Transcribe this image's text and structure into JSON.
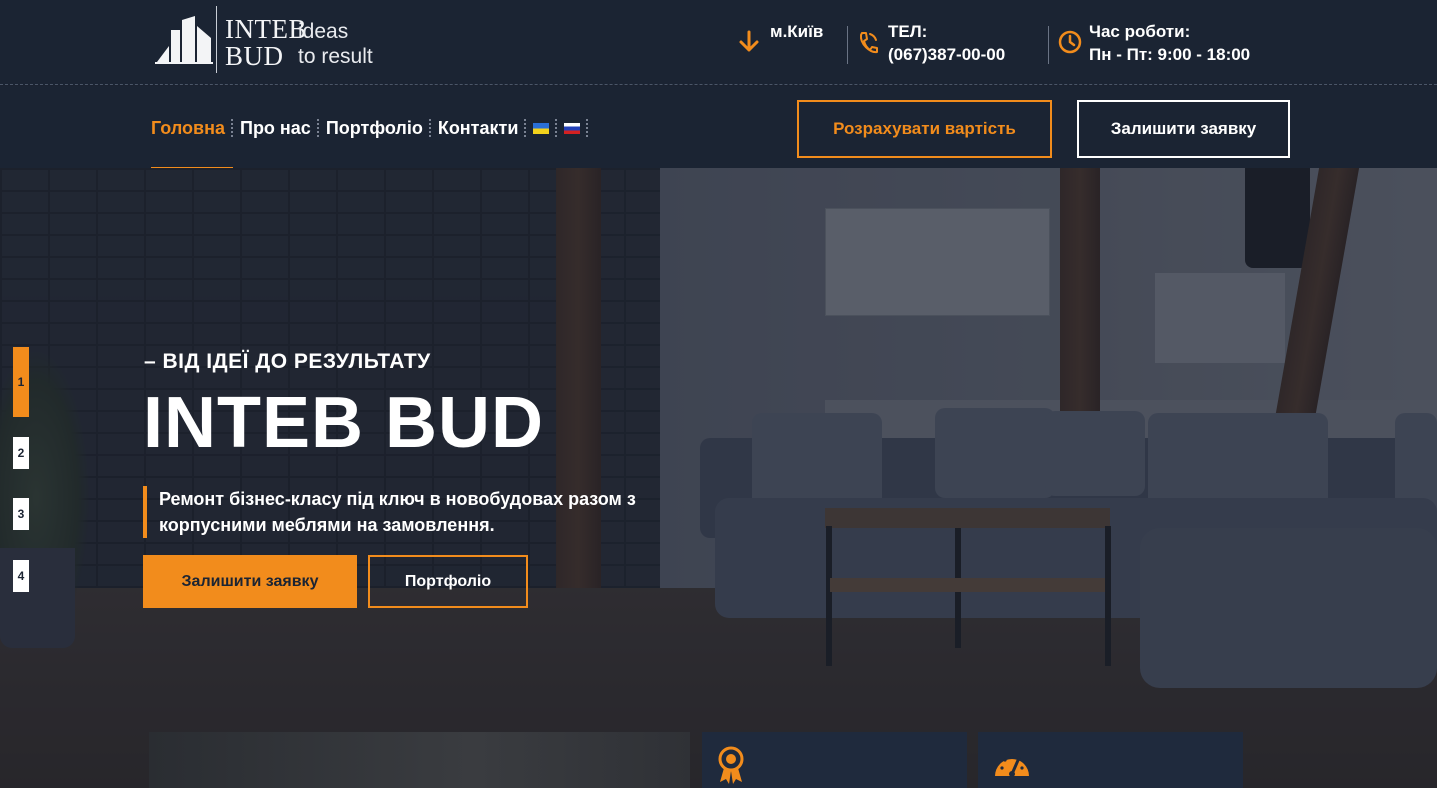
{
  "header": {
    "logo": {
      "word1": "INTEB",
      "word2": "BUD",
      "tag1": "ideas",
      "tag2": "to result"
    },
    "city": {
      "icon": "arrow-down-icon",
      "label": "м.Київ"
    },
    "phone": {
      "icon": "phone-icon",
      "title": "ТЕЛ:",
      "number": "(067)387-00-00"
    },
    "hours": {
      "icon": "clock-icon",
      "title": "Час роботи:",
      "value": "Пн - Пт: 9:00 - 18:00"
    }
  },
  "nav": {
    "items": [
      {
        "label": "Головна",
        "active": true
      },
      {
        "label": "Про нас",
        "active": false
      },
      {
        "label": "Портфоліо",
        "active": false
      },
      {
        "label": "Контакти",
        "active": false
      }
    ],
    "languages": [
      "ua-flag",
      "ru-flag"
    ],
    "calc_button": "Розрахувати вартість",
    "request_button": "Залишити заявку"
  },
  "hero": {
    "kicker": "– ВІД ІДЕЇ ДО РЕЗУЛЬТАТУ",
    "headline": "INTEB BUD",
    "description": "Ремонт бізнес-класу під ключ в новобудовах разом з корпусними меблями на замовлення.",
    "primary_button": "Залишити заявку",
    "secondary_button": "Портфоліо",
    "slides": [
      "1",
      "2",
      "3",
      "4"
    ],
    "active_slide": "1"
  },
  "cards": {
    "icons": [
      "award-icon",
      "speedometer-icon"
    ]
  },
  "colors": {
    "accent": "#f28c1c",
    "header_bg": "#1b2433",
    "card_bg": "#1f2a3d"
  }
}
